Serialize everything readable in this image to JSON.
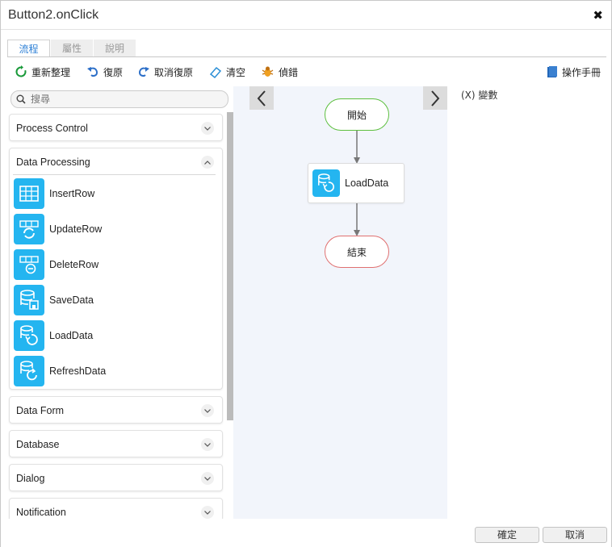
{
  "window": {
    "title": "Button2.onClick"
  },
  "tabs": [
    {
      "label": "流程"
    },
    {
      "label": "屬性"
    },
    {
      "label": "說明"
    }
  ],
  "toolbar": {
    "rearrange": "重新整理",
    "undo": "復原",
    "redo": "取消復原",
    "clear": "清空",
    "debug": "偵錯",
    "manual": "操作手冊"
  },
  "search": {
    "placeholder": "搜尋"
  },
  "palette": {
    "sections": [
      {
        "label": "Process Control"
      },
      {
        "label": "Data Processing"
      },
      {
        "label": "Data Form"
      },
      {
        "label": "Database"
      },
      {
        "label": "Dialog"
      },
      {
        "label": "Notification"
      }
    ],
    "data_processing_items": [
      {
        "label": "InsertRow",
        "icon": "table-grid-icon"
      },
      {
        "label": "UpdateRow",
        "icon": "table-refresh-icon"
      },
      {
        "label": "DeleteRow",
        "icon": "table-delete-icon"
      },
      {
        "label": "SaveData",
        "icon": "database-save-icon"
      },
      {
        "label": "LoadData",
        "icon": "database-load-icon"
      },
      {
        "label": "RefreshData",
        "icon": "database-refresh-icon"
      }
    ]
  },
  "flow": {
    "start": "開始",
    "step": "LoadData",
    "end": "結束"
  },
  "variables": {
    "label": "(X) 變數"
  },
  "footer": {
    "ok": "確定",
    "cancel": "取消"
  },
  "colors": {
    "accent": "#24b5f0",
    "start_border": "#5cbf3e",
    "end_border": "#e07070",
    "canvas_bg": "#f2f5fb"
  }
}
